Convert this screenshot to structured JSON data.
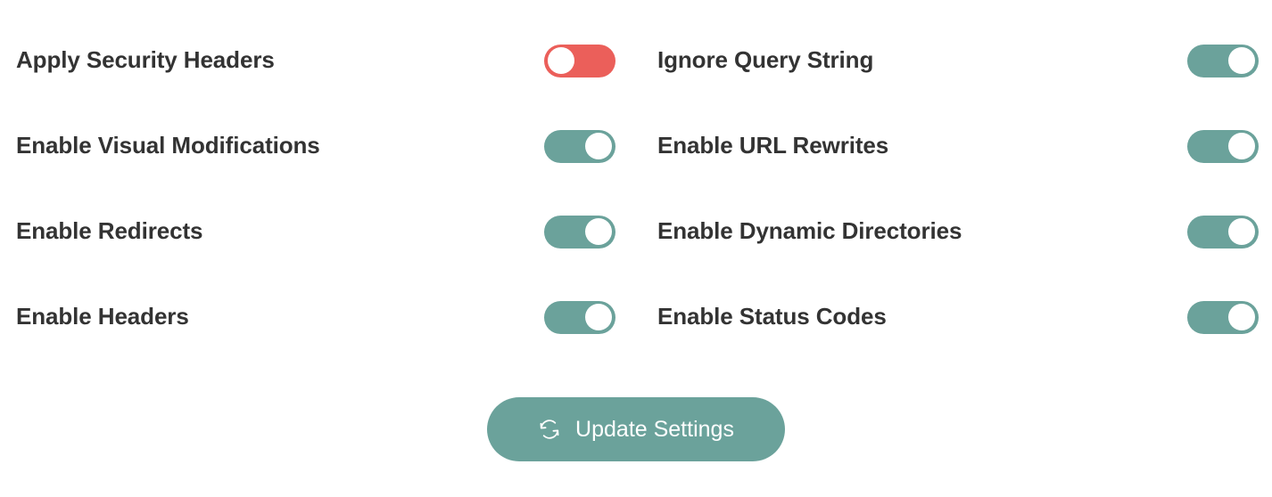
{
  "colors": {
    "accent": "#6ba29b",
    "danger": "#eb5f5a",
    "text": "#333333",
    "background": "#ffffff",
    "knob": "#ffffff",
    "button_text": "#ffffff"
  },
  "settings": {
    "rows": [
      {
        "left": {
          "label": "Apply Security Headers",
          "state": "off",
          "state_label": "Off"
        },
        "right": {
          "label": "Ignore Query String",
          "state": "on",
          "state_label": "On"
        }
      },
      {
        "left": {
          "label": "Enable Visual Modifications",
          "state": "on",
          "state_label": "On"
        },
        "right": {
          "label": "Enable URL Rewrites",
          "state": "on",
          "state_label": "On"
        }
      },
      {
        "left": {
          "label": "Enable Redirects",
          "state": "on",
          "state_label": "On"
        },
        "right": {
          "label": "Enable Dynamic Directories",
          "state": "on",
          "state_label": "On"
        }
      },
      {
        "left": {
          "label": "Enable Headers",
          "state": "on",
          "state_label": "On"
        },
        "right": {
          "label": "Enable Status Codes",
          "state": "on",
          "state_label": "On"
        }
      }
    ]
  },
  "footer": {
    "update_button": {
      "label": "Update Settings",
      "icon": "refresh-icon"
    }
  }
}
